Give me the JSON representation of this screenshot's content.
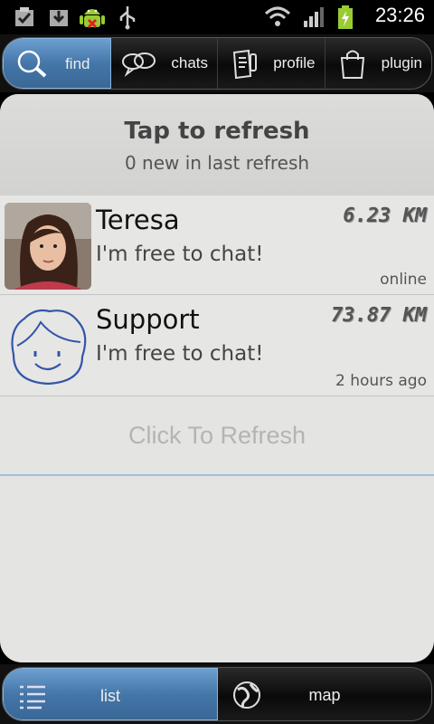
{
  "status_bar": {
    "time": "23:26",
    "icons": [
      "checklist-icon",
      "download-icon",
      "android-icon",
      "usb-icon",
      "wifi-icon",
      "signal-icon",
      "battery-charging-icon"
    ]
  },
  "top_tabs": [
    {
      "label": "find",
      "icon": "search-icon",
      "active": true
    },
    {
      "label": "chats",
      "icon": "chat-bubbles-icon",
      "active": false
    },
    {
      "label": "profile",
      "icon": "profile-card-icon",
      "active": false
    },
    {
      "label": "plugin",
      "icon": "shopping-bag-icon",
      "active": false
    }
  ],
  "refresh_header": {
    "title": "Tap to refresh",
    "subtitle": "0 new in last refresh"
  },
  "users": [
    {
      "name": "Teresa",
      "message": "I'm free to chat!",
      "distance": "6.23 KM",
      "last_seen": "online",
      "avatar": "photo-avatar"
    },
    {
      "name": "Support",
      "message": "I'm free to chat!",
      "distance": "73.87 KM",
      "last_seen": "2 hours ago",
      "avatar": "cartoon-face-avatar"
    }
  ],
  "click_refresh_label": "Click To Refresh",
  "bottom_tabs": [
    {
      "label": "list",
      "icon": "list-icon",
      "active": true
    },
    {
      "label": "map",
      "icon": "globe-icon",
      "active": false
    }
  ],
  "colors": {
    "accent": "#4476a9",
    "card_bg": "#e4e4e2",
    "divider_accent": "#9dc0e2"
  }
}
